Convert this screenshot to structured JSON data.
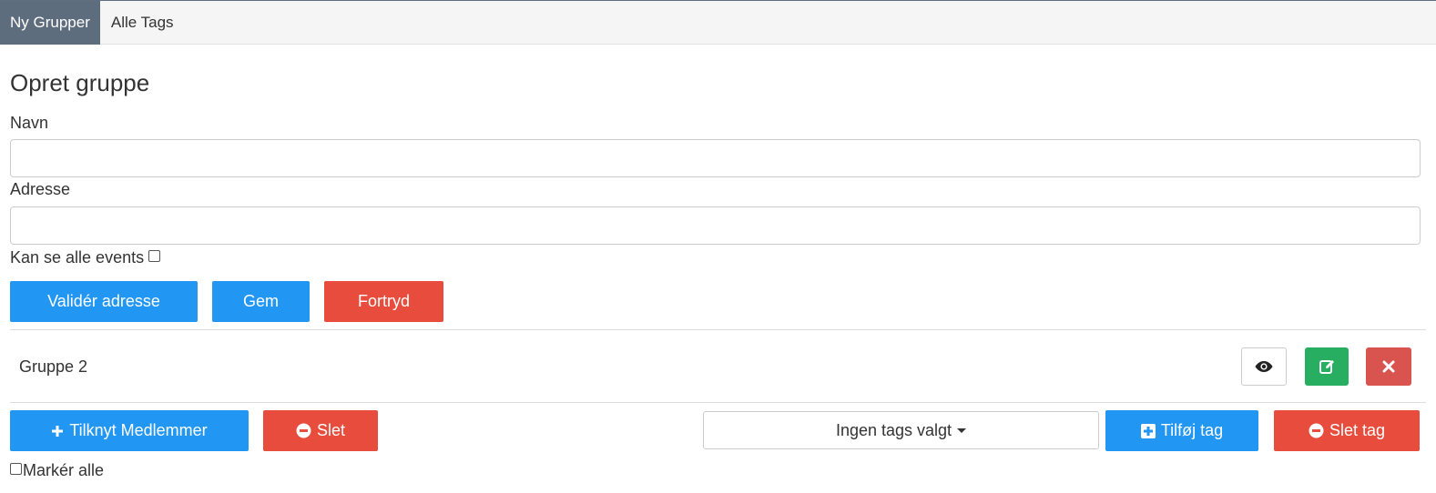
{
  "tabs": [
    {
      "label": "Ny Grupper",
      "active": true
    },
    {
      "label": "Alle Tags",
      "active": false
    }
  ],
  "form": {
    "title": "Opret gruppe",
    "name_label": "Navn",
    "name_value": "",
    "address_label": "Adresse",
    "address_value": "",
    "see_all_label": "Kan se alle events",
    "see_all_checked": false
  },
  "actions": {
    "validate_label": "Validér adresse",
    "save_label": "Gem",
    "cancel_label": "Fortryd"
  },
  "group_row": {
    "name": "Gruppe 2",
    "view_icon": "eye-icon",
    "edit_icon": "edit-icon",
    "delete_icon": "close-icon"
  },
  "toolbar": {
    "attach_label": "Tilknyt Medlemmer",
    "delete_label": "Slet",
    "tags_dropdown_label": "Ingen tags valgt",
    "add_tag_label": "Tilføj tag",
    "delete_tag_label": "Slet tag"
  },
  "select_all_label": "Markér alle",
  "colors": {
    "primary": "#2196f3",
    "danger": "#e74c3c",
    "success": "#27ae60",
    "tab_active": "#5d6d7e"
  }
}
